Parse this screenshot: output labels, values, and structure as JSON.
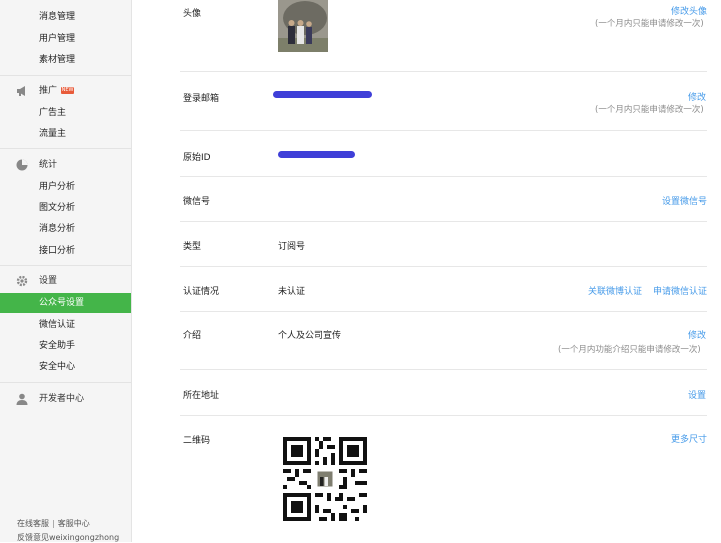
{
  "sidebar": {
    "top_items": [
      {
        "label": "消息管理"
      },
      {
        "label": "用户管理"
      },
      {
        "label": "素材管理"
      }
    ],
    "promo_group": {
      "label": "推广",
      "icon": "megaphone-icon",
      "badge": "NEW"
    },
    "promo_items": [
      {
        "label": "广告主"
      },
      {
        "label": "流量主"
      }
    ],
    "stats_group": {
      "label": "统计",
      "icon": "pie-chart-icon"
    },
    "stats_items": [
      {
        "label": "用户分析"
      },
      {
        "label": "图文分析"
      },
      {
        "label": "消息分析"
      },
      {
        "label": "接口分析"
      }
    ],
    "settings_group": {
      "label": "设置",
      "icon": "gear-icon"
    },
    "settings_items": [
      {
        "label": "公众号设置",
        "active": true
      },
      {
        "label": "微信认证"
      },
      {
        "label": "安全助手"
      },
      {
        "label": "安全中心"
      }
    ],
    "dev_group": {
      "label": "开发者中心",
      "icon": "person-icon"
    },
    "footer": {
      "link1": "在线客服",
      "separator": "|",
      "link2": "客服中心",
      "note": "反馈意见weixingongzhong"
    }
  },
  "settings": {
    "avatar": {
      "label": "头像",
      "action": "修改头像",
      "hint": "(一个月内只能申请修改一次)"
    },
    "email": {
      "label": "登录邮箱",
      "action": "修改",
      "hint": "(一个月内只能申请修改一次)"
    },
    "original_id": {
      "label": "原始ID"
    },
    "wechat_id": {
      "label": "微信号",
      "action": "设置微信号"
    },
    "type": {
      "label": "类型",
      "value": "订阅号"
    },
    "verification": {
      "label": "认证情况",
      "value": "未认证",
      "action1": "关联微博认证",
      "action2": "申请微信认证"
    },
    "intro": {
      "label": "介绍",
      "value": "个人及公司宣传",
      "action": "修改",
      "hint": "(一个月内功能介绍只能申请修改一次)"
    },
    "location": {
      "label": "所在地址",
      "action": "设置"
    },
    "qrcode": {
      "label": "二维码",
      "action": "更多尺寸"
    }
  },
  "colors": {
    "accent_green": "#44b549",
    "link_blue": "#459ae9",
    "redaction": "#3f3fd8"
  }
}
